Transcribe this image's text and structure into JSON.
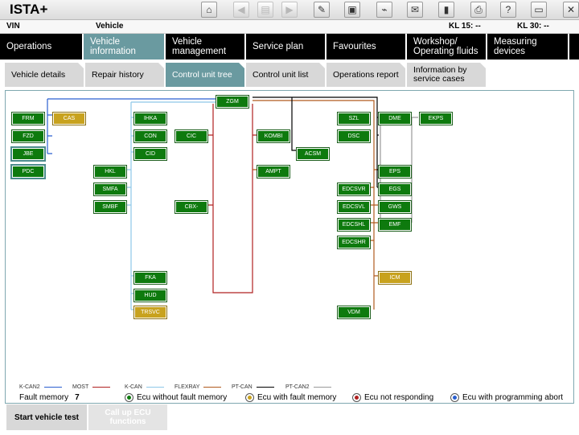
{
  "app": {
    "title": "ISTA+"
  },
  "toolbar": {
    "buttons": [
      {
        "name": "home-icon",
        "glyph": "⌂",
        "enabled": true
      },
      {
        "name": "back-icon",
        "glyph": "◀",
        "enabled": false
      },
      {
        "name": "document-icon",
        "glyph": "▤",
        "enabled": false
      },
      {
        "name": "forward-icon",
        "glyph": "▶",
        "enabled": false
      },
      {
        "name": "wrench-icon",
        "glyph": "✎",
        "enabled": true
      },
      {
        "name": "vehicle-id-icon",
        "glyph": "▣",
        "enabled": true
      },
      {
        "name": "connection-icon",
        "glyph": "⌁",
        "enabled": true
      },
      {
        "name": "mail-icon",
        "glyph": "✉",
        "enabled": true
      },
      {
        "name": "battery-icon",
        "glyph": "▮",
        "enabled": true
      },
      {
        "name": "print-icon",
        "glyph": "⎙",
        "enabled": true
      },
      {
        "name": "help-icon",
        "glyph": "?",
        "enabled": true
      },
      {
        "name": "minimize-icon",
        "glyph": "▭",
        "enabled": true
      },
      {
        "name": "close-icon",
        "glyph": "✕",
        "enabled": true
      }
    ]
  },
  "infobar": {
    "vin_label": "VIN",
    "vehicle_label": "Vehicle",
    "kl15": "KL 15:  --",
    "kl30": "KL 30:  --"
  },
  "nav": {
    "tabs": [
      {
        "label": "Operations"
      },
      {
        "label": "Vehicle information",
        "active": true
      },
      {
        "label": "Vehicle management"
      },
      {
        "label": "Service plan"
      },
      {
        "label": "Favourites"
      },
      {
        "label": "Workshop/ Operating fluids"
      },
      {
        "label": "Measuring devices"
      }
    ]
  },
  "subnav": {
    "tabs": [
      {
        "label": "Vehicle details"
      },
      {
        "label": "Repair history"
      },
      {
        "label": "Control unit tree",
        "active": true
      },
      {
        "label": "Control unit list"
      },
      {
        "label": "Operations report"
      },
      {
        "label": "Information by service cases"
      }
    ]
  },
  "ecus": [
    {
      "label": "ZGM",
      "status": "ok"
    },
    {
      "label": "FRM",
      "status": "ok"
    },
    {
      "label": "CAS",
      "status": "fault"
    },
    {
      "label": "FZD",
      "status": "ok"
    },
    {
      "label": "JBE",
      "status": "ok",
      "selected": true
    },
    {
      "label": "PDC",
      "status": "ok",
      "selected": true
    },
    {
      "label": "IHKA",
      "status": "ok"
    },
    {
      "label": "CON",
      "status": "ok"
    },
    {
      "label": "CID",
      "status": "ok"
    },
    {
      "label": "CIC",
      "status": "ok"
    },
    {
      "label": "HKL",
      "status": "ok"
    },
    {
      "label": "SMFA",
      "status": "ok"
    },
    {
      "label": "SMBF",
      "status": "ok"
    },
    {
      "label": "CBX-MEDIA",
      "status": "ok"
    },
    {
      "label": "FKA",
      "status": "ok"
    },
    {
      "label": "HUD",
      "status": "ok"
    },
    {
      "label": "TRSVC",
      "status": "fault"
    },
    {
      "label": "KOMBI",
      "status": "ok"
    },
    {
      "label": "ACSM",
      "status": "ok"
    },
    {
      "label": "AMPT",
      "status": "ok"
    },
    {
      "label": "SZL",
      "status": "ok"
    },
    {
      "label": "DSC",
      "status": "ok"
    },
    {
      "label": "DME",
      "status": "ok"
    },
    {
      "label": "EKPS",
      "status": "ok"
    },
    {
      "label": "EPS",
      "status": "ok"
    },
    {
      "label": "EGS",
      "status": "ok"
    },
    {
      "label": "GWS",
      "status": "ok"
    },
    {
      "label": "EMF",
      "status": "ok"
    },
    {
      "label": "EDCSVR",
      "status": "ok"
    },
    {
      "label": "EDCSVL",
      "status": "ok"
    },
    {
      "label": "EDCSHL",
      "status": "ok"
    },
    {
      "label": "EDCSHR",
      "status": "ok"
    },
    {
      "label": "ICM",
      "status": "fault"
    },
    {
      "label": "VDM",
      "status": "ok"
    }
  ],
  "legend": {
    "buses": [
      {
        "label": "K-CAN2",
        "color": "#2a5fd0"
      },
      {
        "label": "MOST",
        "color": "#b02020"
      },
      {
        "label": "K-CAN",
        "color": "#8ec8e8"
      },
      {
        "label": "FLEXRAY",
        "color": "#b05a1e"
      },
      {
        "label": "PT-CAN",
        "color": "#000000"
      },
      {
        "label": "PT-CAN2",
        "color": "#9a9a9a"
      }
    ],
    "fault_memory_label": "Fault memory",
    "fault_memory_count": "7",
    "statuses": [
      {
        "label": "Ecu without fault memory",
        "color": "#0e7a0e"
      },
      {
        "label": "Ecu with fault memory",
        "color": "#c8a21e"
      },
      {
        "label": "Ecu not responding",
        "color": "#b02020"
      },
      {
        "label": "Ecu with programming abort",
        "color": "#2a5fd0"
      }
    ]
  },
  "actions": {
    "start": "Start vehicle test",
    "callup": "Call up ECU functions"
  }
}
